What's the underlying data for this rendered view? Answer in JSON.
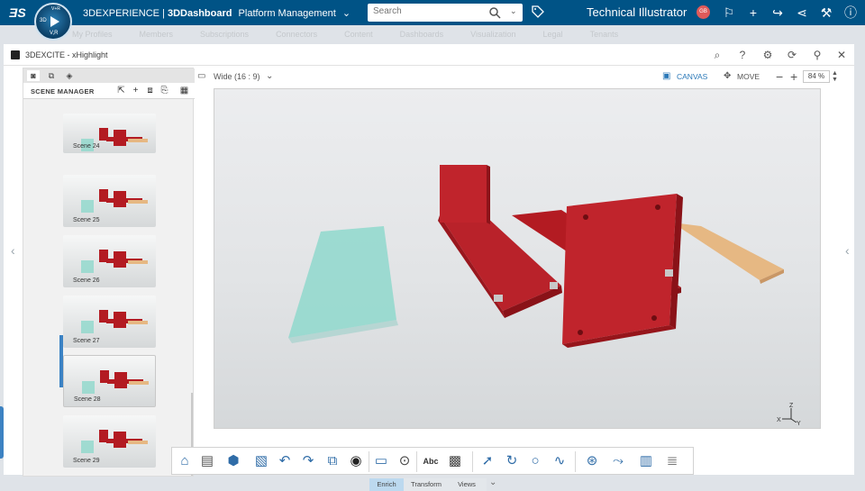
{
  "topbar": {
    "brand": "3DEXPERIENCE | ",
    "brand_bold": "3DDashboard",
    "context": "Platform Management",
    "compass_top": "V+R",
    "compass_left": "3D",
    "compass_bottom": "V,R",
    "search_placeholder": "Search",
    "user_name": "Technical Illustrator",
    "user_initials": "GB"
  },
  "nav_tabs": [
    "My Profiles",
    "Members",
    "Subscriptions",
    "Connectors",
    "Content",
    "Dashboards",
    "Visualization",
    "Legal",
    "Tenants"
  ],
  "widget": {
    "title": "3DEXCITE - xHighlight"
  },
  "scene_manager": {
    "title": "SCENE MANAGER",
    "scenes": [
      {
        "label": "Scene 24"
      },
      {
        "label": "Scene 25"
      },
      {
        "label": "Scene 26"
      },
      {
        "label": "Scene 27"
      },
      {
        "label": "Scene 28"
      },
      {
        "label": "Scene 29"
      }
    ],
    "selected": "Scene 28"
  },
  "viewport_toolbar": {
    "aspect": "Wide (16 : 9)",
    "canvas_label": "CANVAS",
    "move_label": "MOVE",
    "zoom": "84 %"
  },
  "axes": {
    "z": "Z",
    "x": "X",
    "y": "Y"
  },
  "bottom_tabs": [
    "Enrich",
    "Transform",
    "Views"
  ],
  "active_bottom_tab": "Enrich",
  "tools": {
    "text_tool": "Abc"
  },
  "colors": {
    "topbar": "#005386",
    "accent": "#3b82c4",
    "part_red": "#b31b22",
    "part_teal": "#8fd8cc",
    "part_wood": "#e6b883"
  }
}
